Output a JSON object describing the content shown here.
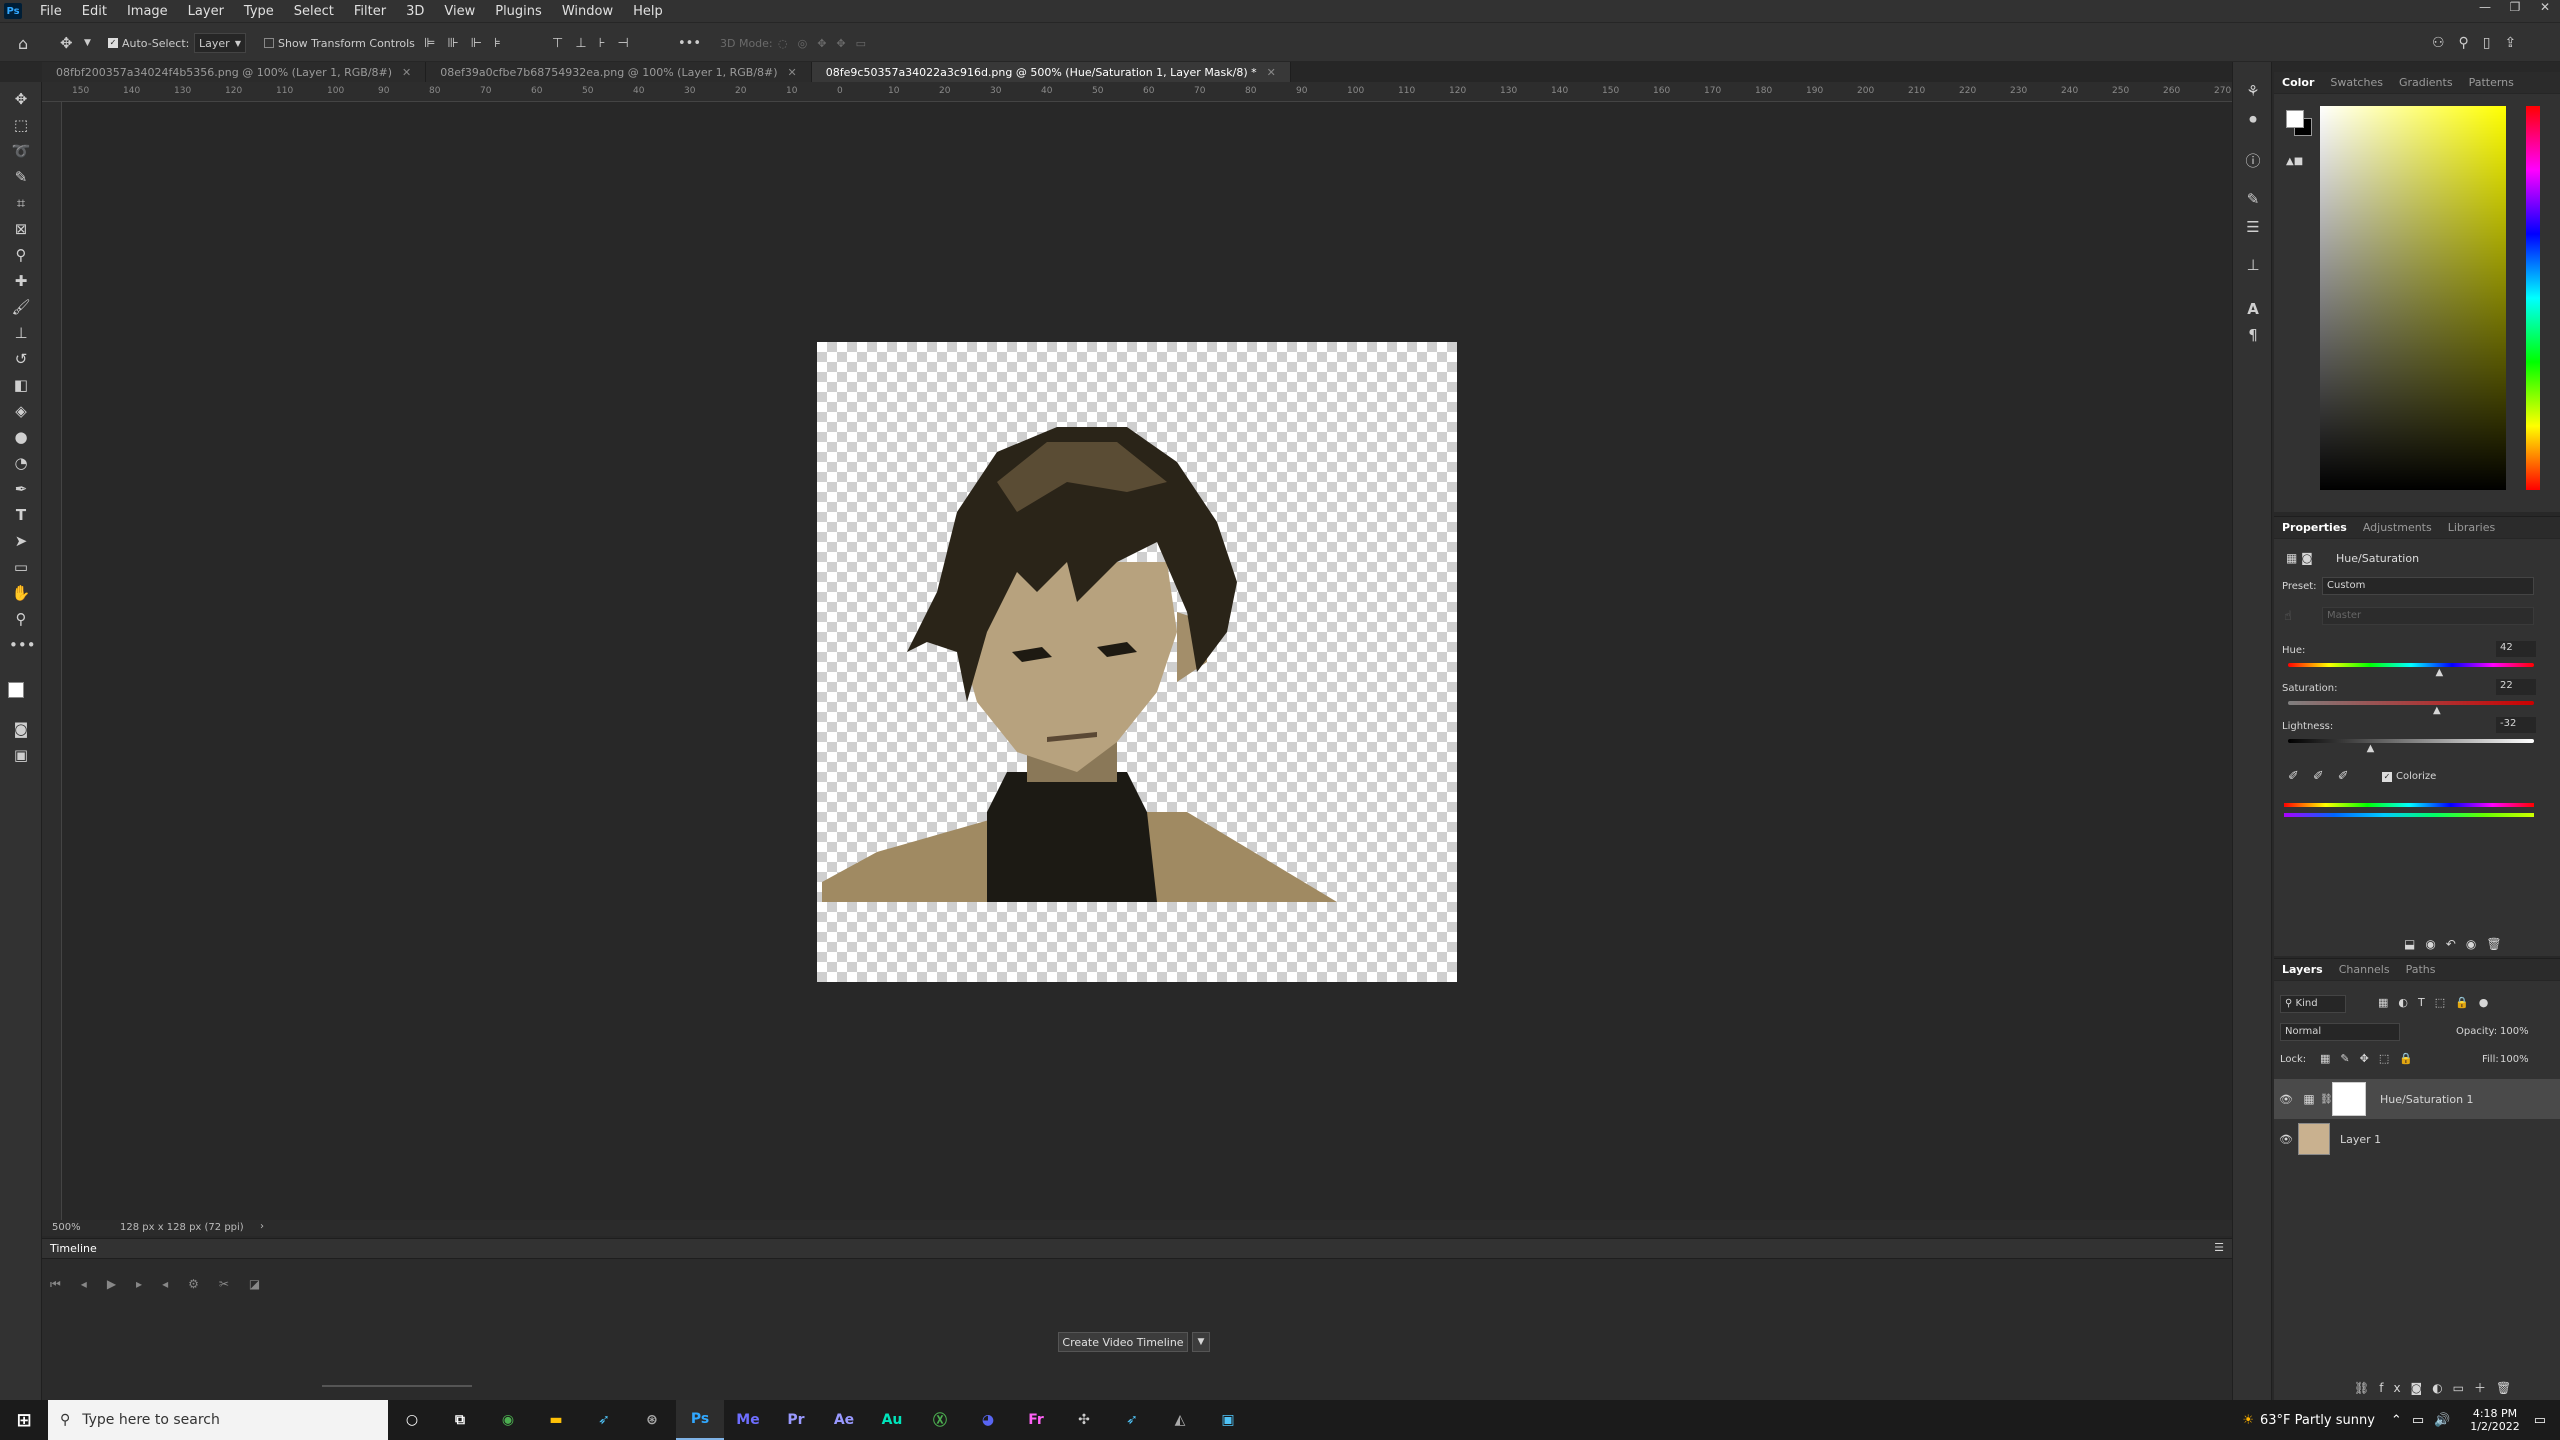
{
  "menubar": {
    "app_icon": "Ps",
    "items": [
      "File",
      "Edit",
      "Image",
      "Layer",
      "Type",
      "Select",
      "Filter",
      "3D",
      "View",
      "Plugins",
      "Window",
      "Help"
    ]
  },
  "options": {
    "auto_select_label": "Auto-Select:",
    "auto_select_target": "Layer",
    "show_transform_label": "Show Transform Controls",
    "mode_3d_label": "3D Mode:",
    "more_icon": "•••"
  },
  "tabs": [
    {
      "label": "08fbf200357a34024f4b5356.png @ 100% (Layer 1, RGB/8#)",
      "active": false
    },
    {
      "label": "08ef39a0cfbe7b68754932ea.png @ 100% (Layer 1, RGB/8#)",
      "active": false
    },
    {
      "label": "08fe9c50357a34022a3c916d.png @ 500% (Hue/Saturation 1, Layer Mask/8) *",
      "active": true
    }
  ],
  "ruler_h": [
    "150",
    "140",
    "130",
    "120",
    "110",
    "100",
    "90",
    "80",
    "70",
    "60",
    "50",
    "40",
    "30",
    "20",
    "10",
    "0",
    "10",
    "20",
    "30",
    "40",
    "50",
    "60",
    "70",
    "80",
    "90",
    "100",
    "110",
    "120",
    "130",
    "140",
    "150",
    "160",
    "170",
    "180",
    "190",
    "200",
    "210",
    "220",
    "230",
    "240",
    "250",
    "260",
    "270"
  ],
  "status": {
    "zoom": "500%",
    "doc_info": "128 px x 128 px (72 ppi)"
  },
  "timeline": {
    "title": "Timeline",
    "create_button": "Create Video Timeline"
  },
  "color_panel": {
    "tabs": [
      "Color",
      "Swatches",
      "Gradients",
      "Patterns"
    ],
    "hue_color": "#ffff00"
  },
  "properties": {
    "tabs": [
      "Properties",
      "Adjustments",
      "Libraries"
    ],
    "adjustment_name": "Hue/Saturation",
    "preset_label": "Preset:",
    "preset_value": "Custom",
    "channel_value": "Master",
    "hue_label": "Hue:",
    "hue_value": "42",
    "saturation_label": "Saturation:",
    "saturation_value": "22",
    "lightness_label": "Lightness:",
    "lightness_value": "-32",
    "colorize_label": "Colorize",
    "hue_fraction": 0.62,
    "saturation_fraction": 0.61,
    "lightness_fraction": 0.34
  },
  "layers": {
    "tabs": [
      "Layers",
      "Channels",
      "Paths"
    ],
    "filter_label": "Kind",
    "blend_mode": "Normal",
    "opacity_label": "Opacity:",
    "opacity_value": "100%",
    "lock_label": "Lock:",
    "fill_label": "Fill:",
    "fill_value": "100%",
    "items": [
      {
        "name": "Hue/Saturation 1"
      },
      {
        "name": "Layer 1"
      }
    ]
  },
  "taskbar": {
    "search_placeholder": "Type here to search",
    "apps": [
      "Me",
      "Pr",
      "Ae",
      "Au",
      "Fr"
    ],
    "weather": "63°F  Partly sunny",
    "time": "4:18 PM",
    "date": "1/2/2022"
  }
}
